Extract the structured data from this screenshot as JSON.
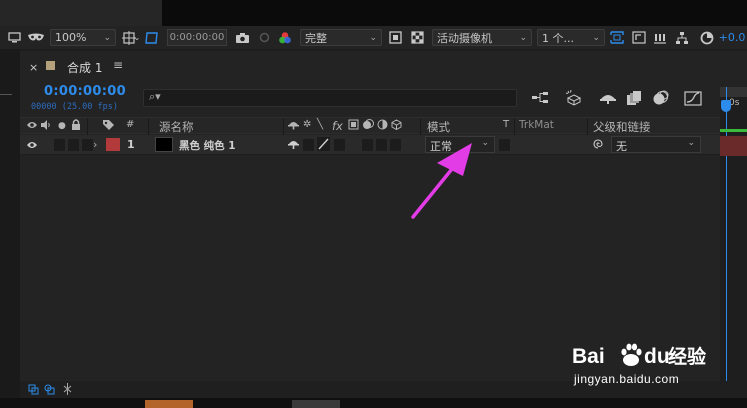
{
  "toolbar": {
    "zoom": "100%",
    "timecode": "0:00:00:00",
    "resolution": "完整",
    "camera": "活动摄像机",
    "views": "1 个...",
    "exposure": "+0.0"
  },
  "comp_tab": {
    "close": "×",
    "title": "合成 1",
    "menu": "≡"
  },
  "timeline": {
    "current_time": "0:00:00:00",
    "fps_info": "00000 (25.00 fps)",
    "search_placeholder": "",
    "ruler_label": "0s"
  },
  "columns": {
    "number": "#",
    "source_name": "源名称",
    "fx": "fx",
    "mode": "模式",
    "t": "T",
    "trkmat": "TrkMat",
    "parent": "父级和链接"
  },
  "layers": [
    {
      "number": "1",
      "name": "黑色 纯色 1",
      "mode": "正常",
      "parent": "无",
      "label_color": "#b33a3a"
    }
  ],
  "colors": {
    "accent": "#2d8ceb",
    "arrow": "#e23ce6"
  },
  "watermark": {
    "brand_a": "Bai",
    "brand_b": "du",
    "brand_c": "经验",
    "url": "jingyan.baidu.com"
  }
}
